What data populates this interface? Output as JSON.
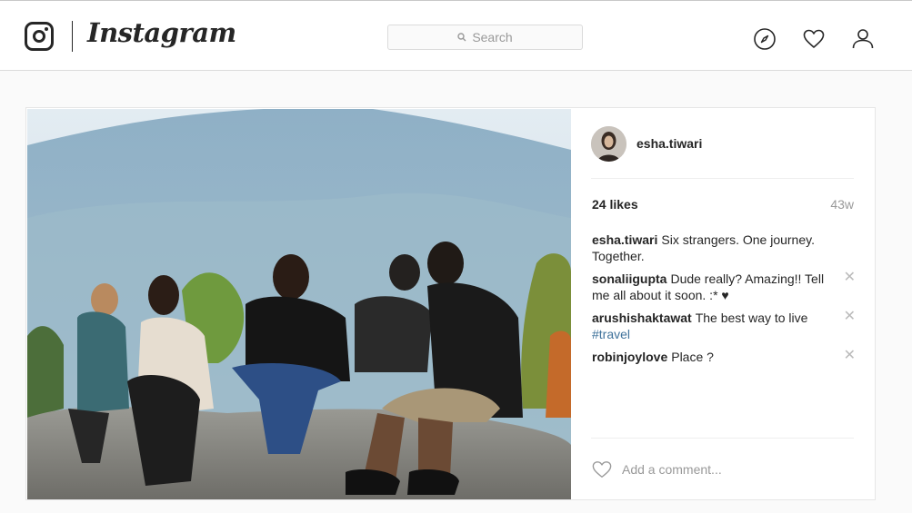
{
  "header": {
    "wordmark": "Instagram",
    "search_placeholder": "Search",
    "icons": [
      "instagram-glyph-icon",
      "search-icon",
      "explore-compass-icon",
      "activity-heart-icon",
      "profile-user-icon"
    ]
  },
  "post": {
    "author": "esha.tiwari",
    "likes": "24 likes",
    "age": "43w",
    "comments": [
      {
        "user": "esha.tiwari",
        "text": "Six strangers. One journey. Together.",
        "deletable": false
      },
      {
        "user": "sonaliigupta",
        "text": "Dude really? Amazing!! Tell me all about it soon. :* ♥",
        "deletable": true
      },
      {
        "user": "arushishaktawat",
        "text": "The best way to live",
        "hashtag": "#travel",
        "deletable": true
      },
      {
        "user": "robinjoylove",
        "text": "Place ?",
        "deletable": true
      }
    ],
    "delete_glyph": "✕",
    "add_comment_placeholder": "Add a comment..."
  },
  "colors": {
    "background": "#fafafa",
    "text": "#262626",
    "muted": "#999999",
    "hashtag": "#3f729b",
    "border": "#dbdbdb"
  }
}
